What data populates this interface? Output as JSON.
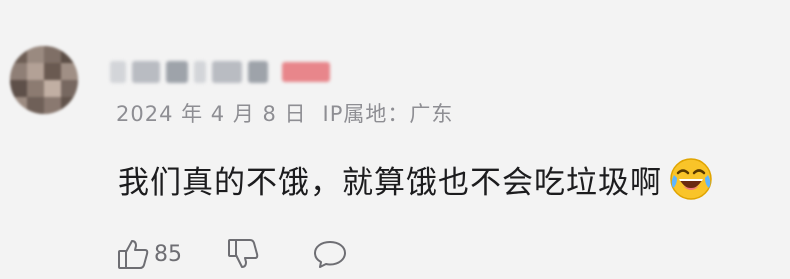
{
  "comment": {
    "date": "2024 年 4 月 8 日",
    "ip_location": "IP属地：广东",
    "text": "我们真的不饿，就算饿也不会吃垃圾啊",
    "emoji": "laughing-crying-emoji",
    "like_count": "85",
    "icons": {
      "like": "thumbs-up-icon",
      "dislike": "thumbs-down-icon",
      "reply": "chat-bubble-icon"
    },
    "colors": {
      "background": "#f3f3f3",
      "text": "#1c1c1e",
      "meta": "#8e8e93",
      "icon": "#6e6e73"
    }
  }
}
